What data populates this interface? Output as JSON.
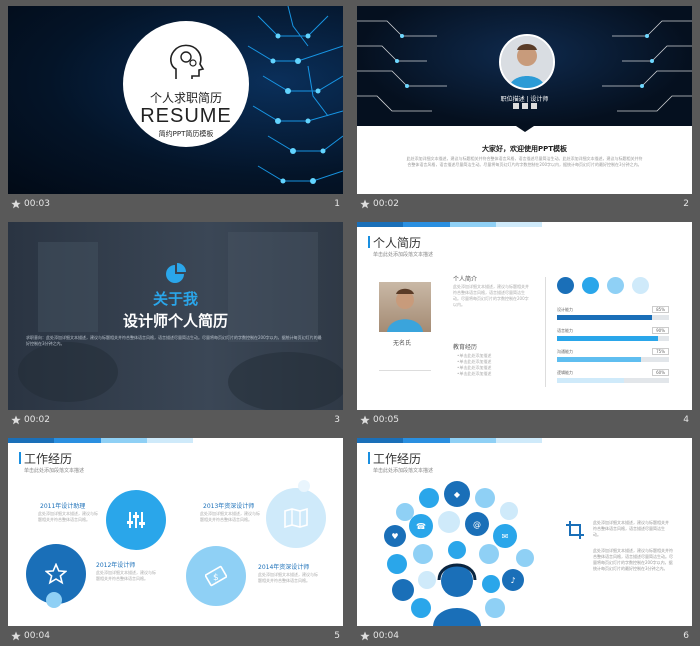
{
  "slides": [
    {
      "time": "00:03",
      "number": "1",
      "title_cn": "个人求职简历",
      "title_en": "RESUME",
      "subtitle": "简约PPT简历模板"
    },
    {
      "time": "00:02",
      "number": "2",
      "role": "职位描述 | 设计师",
      "greeting": "大家好，欢迎使用PPT模板",
      "paragraph": "此处添加详细文本描述，建议与标题相关并符合整体语言风格，语言描述尽量简洁生动。此处添加详细文本描述，建议与标题相关并符合整体语言风格，语言描述尽量简洁生动。尽量将每页幻灯片的字数控制在200字以内，据统计每页幻灯片的最好控制在3分钟之内。"
    },
    {
      "time": "00:02",
      "number": "3",
      "heading1": "关于我",
      "heading2": "设计师个人简历",
      "desc": "求职意向：此处添加详细文本描述，建议与标题相关并符合整体语言风格，语言描述尽量简洁生动。尽量将每页幻灯片的字数控制在200字以内，据统计每页幻灯片的最好控制在3分钟之内。"
    },
    {
      "time": "00:05",
      "number": "4",
      "title": "个人简历",
      "subtitle": "单击此处添加段落文本描述",
      "intro_title": "个人简介",
      "name": "无名氏",
      "edu_title": "教育经历",
      "edu_items": [
        "•单击此处添加描述",
        "•单击此处添加描述",
        "•单击此处添加描述",
        "•单击此处添加描述"
      ],
      "intro_text": "此处添加详细文本描述，建议与标题相关并符合整体语言风格，语言描述尽量简洁生动。尽量将每页幻灯片的字数控制在200字以内。",
      "skills": [
        {
          "label": "设计能力",
          "pct": "85%",
          "value": 0.85
        },
        {
          "label": "语言能力",
          "pct": "90%",
          "value": 0.9
        },
        {
          "label": "沟通能力",
          "pct": "75%",
          "value": 0.75
        },
        {
          "label": "逻辑能力",
          "pct": "60%",
          "value": 0.6
        }
      ]
    },
    {
      "time": "00:04",
      "number": "5",
      "title": "工作经历",
      "subtitle": "单击此处添加段落文本描述",
      "items": [
        {
          "year": "2011年设计助理",
          "text": "此处添加详细文本描述，建议与标题相关并符合整体语言风格。"
        },
        {
          "year": "2013年资深设计师",
          "text": "此处添加详细文本描述，建议与标题相关并符合整体语言风格。"
        },
        {
          "year": "2012年设计师",
          "text": "此处添加详细文本描述，建议与标题相关并符合整体语言风格。"
        },
        {
          "year": "2014年资深设计师",
          "text": "此处添加详细文本描述，建议与标题相关并符合整体语言风格。"
        }
      ]
    },
    {
      "time": "00:04",
      "number": "6",
      "title": "工作经历",
      "subtitle": "单击此处添加段落文本描述",
      "text1": "此处添加详细文本描述，建议与标题相关并符合整体语言风格，语言描述尽量简洁生动。",
      "text2": "此处添加详细文本描述，建议与标题相关并符合整体语言风格，语言描述尽量简洁生动。尽量将每页幻灯片的字数控制在200字以内，据统计每页幻灯片的最好控制在3分钟之内。"
    }
  ],
  "colors": {
    "primary": "#1a6fb8",
    "light": "#8fd0f5",
    "pale": "#cfeafa",
    "dark": "#0a2540"
  }
}
